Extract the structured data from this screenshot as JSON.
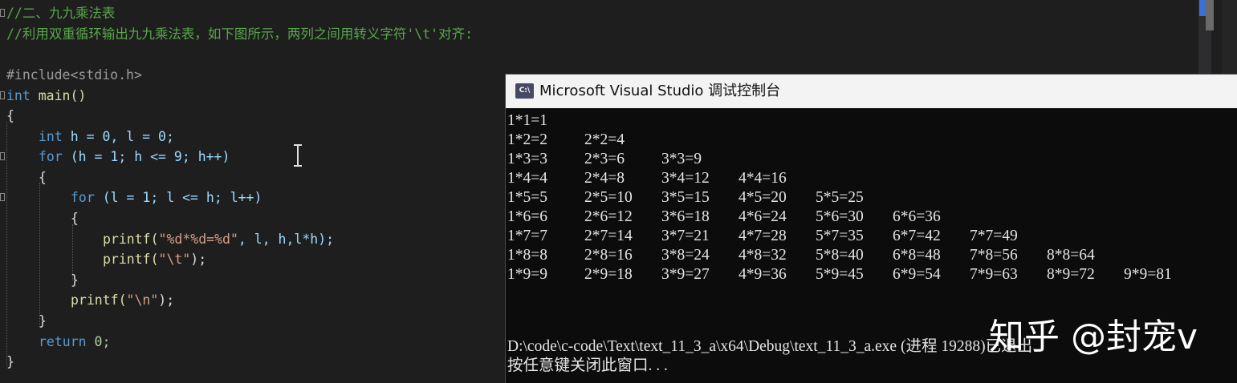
{
  "editor": {
    "comment_title": "//二、九九乘法表",
    "comment_desc": "//利用双重循环输出九九乘法表，如下图所示，两列之间用转义字符'\\t'对齐:",
    "include_line": "#include<stdio.h>",
    "kw_int": "int",
    "main_sig": " main()",
    "brace_open": "{",
    "decl_rest": " h = 0, l = 0;",
    "kw_for": "for",
    "for_outer_rest": " (h = 1; h <= 9; h++)",
    "inner_brace_open": "{",
    "for_inner_rest": " (l = 1; l <= h; l++)",
    "inner2_brace_open": "{",
    "printf1_fn": "printf(",
    "printf1_str": "\"%d*%d=%d\"",
    "printf1_rest": ", l, h,l*h);",
    "printf2_fn": "printf(",
    "printf2_str": "\"\\t\"",
    "printf2_rest": ");",
    "inner2_brace_close": "}",
    "printf3_fn": "printf(",
    "printf3_str": "\"\\n\"",
    "printf3_rest": ");",
    "inner_brace_close": "}",
    "kw_return": "return",
    "return_rest": " 0;",
    "brace_close": "}"
  },
  "console": {
    "icon_text": "C:\\",
    "title": "Microsoft Visual Studio 调试控制台",
    "table": [
      [
        "1*1=1"
      ],
      [
        "1*2=2",
        "2*2=4"
      ],
      [
        "1*3=3",
        "2*3=6",
        "3*3=9"
      ],
      [
        "1*4=4",
        "2*4=8",
        "3*4=12",
        "4*4=16"
      ],
      [
        "1*5=5",
        "2*5=10",
        "3*5=15",
        "4*5=20",
        "5*5=25"
      ],
      [
        "1*6=6",
        "2*6=12",
        "3*6=18",
        "4*6=24",
        "5*6=30",
        "6*6=36"
      ],
      [
        "1*7=7",
        "2*7=14",
        "3*7=21",
        "4*7=28",
        "5*7=35",
        "6*7=42",
        "7*7=49"
      ],
      [
        "1*8=8",
        "2*8=16",
        "3*8=24",
        "4*8=32",
        "5*8=40",
        "6*8=48",
        "7*8=56",
        "8*8=64"
      ],
      [
        "1*9=9",
        "2*9=18",
        "3*9=27",
        "4*9=36",
        "5*9=45",
        "6*9=54",
        "7*9=63",
        "8*9=72",
        "9*9=81"
      ]
    ],
    "exit_message": "D:\\code\\c-code\\Text\\text_11_3_a\\x64\\Debug\\text_11_3_a.exe (进程 19288)已退出",
    "press_key": "按任意键关闭此窗口. . ."
  },
  "watermark": "知乎 @封宠v",
  "colors": {
    "editor_bg": "#1e1e1e",
    "keyword": "#569cd6",
    "comment": "#57a64a",
    "string": "#d69d85",
    "console_bg": "#0c0c0c",
    "console_text": "#e6e6e6"
  }
}
